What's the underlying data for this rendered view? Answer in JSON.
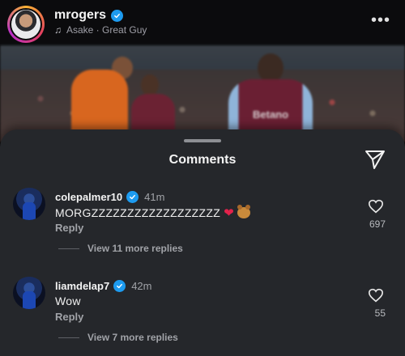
{
  "post": {
    "username": "mrogers",
    "music_line": "Asake · Great Guy",
    "photo_sponsor_text": "Betano"
  },
  "sheet": {
    "title": "Comments"
  },
  "comments": [
    {
      "username": "colepalmer10",
      "time": "41m",
      "text": "MORGZZZZZZZZZZZZZZZZZZ",
      "emojis": [
        "heart",
        "bear-face"
      ],
      "reply_label": "Reply",
      "like_count": "697",
      "more_replies": "View 11 more replies"
    },
    {
      "username": "liamdelap7",
      "time": "42m",
      "text": "Wow",
      "emojis": [],
      "reply_label": "Reply",
      "like_count": "55",
      "more_replies": "View 7 more replies"
    }
  ],
  "colors": {
    "sheet_bg": "#25272b",
    "verified": "#1d9bf0",
    "heart_emoji": "#e3224b"
  },
  "icons": {
    "verified": "verified-badge-icon",
    "music": "music-note-icon",
    "more": "more-options-icon",
    "share": "send-paper-plane-icon",
    "like": "heart-outline-icon"
  }
}
